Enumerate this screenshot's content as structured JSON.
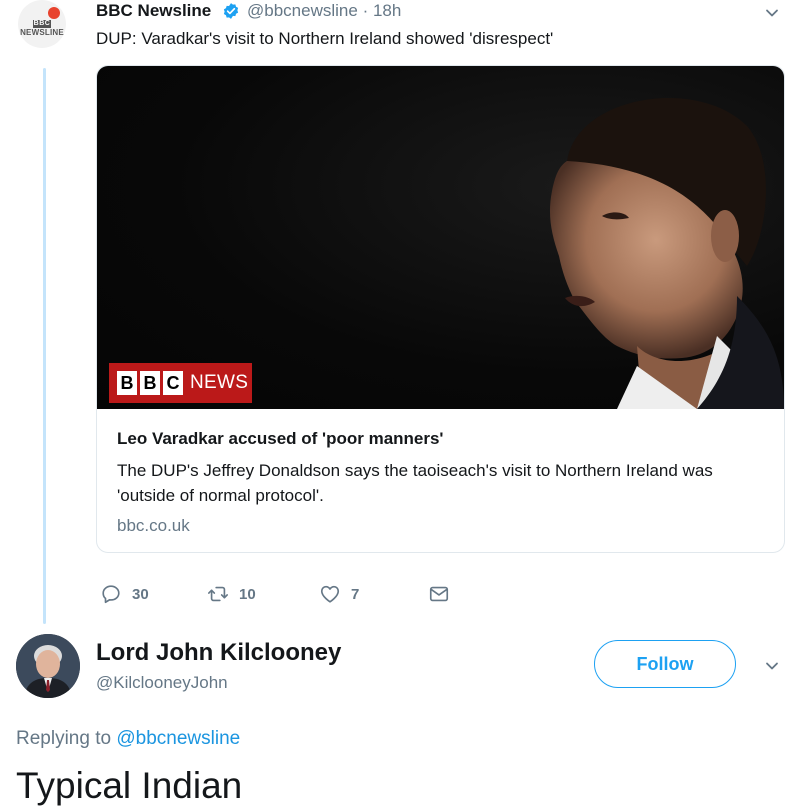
{
  "quoted_tweet": {
    "author_name": "BBC Newsline",
    "handle": "@bbcnewsline",
    "time": "· 18h",
    "avatar": {
      "bbc": "BBC",
      "newsline": "NEWSLINE"
    },
    "text": "DUP: Varadkar's visit to Northern Ireland showed 'disrespect'",
    "card": {
      "banner_letters": [
        "B",
        "B",
        "C"
      ],
      "banner_news": "NEWS",
      "title": "Leo Varadkar accused of 'poor manners'",
      "description": "The DUP's Jeffrey Donaldson says the taoiseach's visit to Northern Ireland was 'outside of normal protocol'.",
      "domain": "bbc.co.uk"
    },
    "actions": {
      "replies": "30",
      "retweets": "10",
      "likes": "7"
    }
  },
  "reply": {
    "author_name": "Lord John Kilclooney",
    "handle": "@KilclooneyJohn",
    "follow_label": "Follow",
    "replying_prefix": "Replying to",
    "replying_to": "@bbcnewsline",
    "text": "Typical Indian"
  },
  "colors": {
    "accent": "#1da1f2",
    "muted": "#657786",
    "thread_line": "#c4e4fb",
    "bbc_red": "#bb1919"
  }
}
